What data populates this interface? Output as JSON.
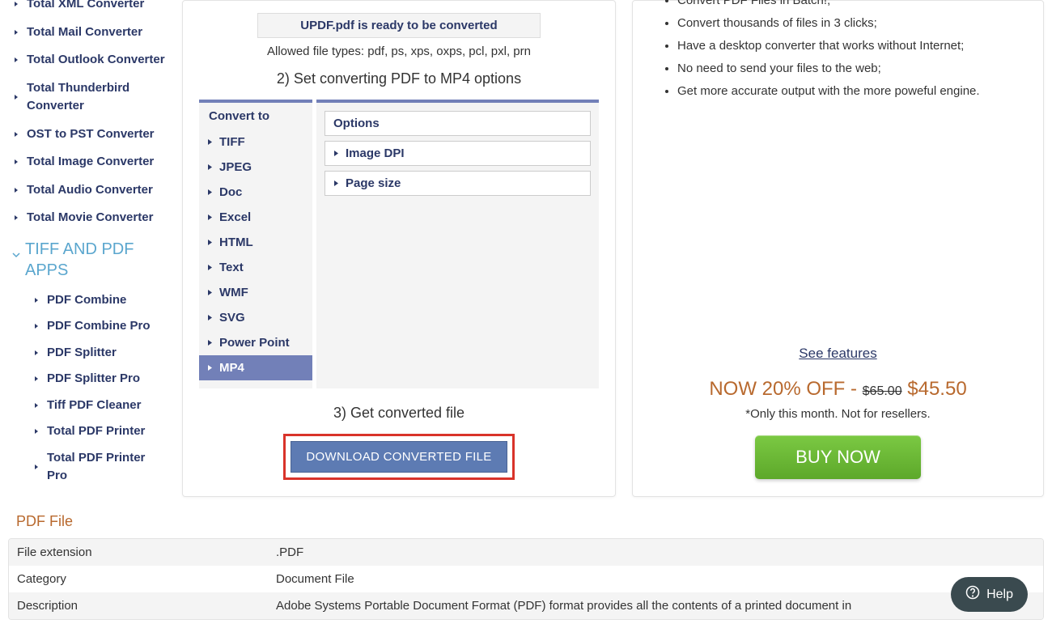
{
  "sidebar": {
    "group1_items": [
      "Total XML Converter",
      "Total Mail Converter",
      "Total Outlook Converter",
      "Total Thunderbird Converter",
      "OST to PST Converter",
      "Total Image Converter",
      "Total Audio Converter",
      "Total Movie Converter"
    ],
    "category_header": "TIFF AND PDF APPS",
    "group2_items": [
      "PDF Combine",
      "PDF Combine Pro",
      "PDF Splitter",
      "PDF Splitter Pro",
      "Tiff PDF Cleaner",
      "Total PDF Printer",
      "Total PDF Printer Pro"
    ]
  },
  "main": {
    "ready_text": "UPDF.pdf is ready to be converted",
    "allowed": "Allowed file types: pdf, ps, xps, oxps, pcl, pxl, prn",
    "step2": "2) Set converting PDF to MP4 options",
    "convert_header": "Convert to",
    "formats": [
      "TIFF",
      "JPEG",
      "Doc",
      "Excel",
      "HTML",
      "Text",
      "WMF",
      "SVG",
      "Power Point",
      "MP4"
    ],
    "active_format_index": 9,
    "options_header": "Options",
    "options": [
      "Image DPI",
      "Page size"
    ],
    "step3": "3) Get converted file",
    "download_label": "DOWNLOAD CONVERTED FILE"
  },
  "right": {
    "bullets": [
      "Convert PDF Files in Batch!;",
      "Convert thousands of files in 3 clicks;",
      "Have a desktop converter that works without Internet;",
      "No need to send your files to the web;",
      "Get more accurate output with the more poweful engine."
    ],
    "see_features": "See features",
    "now_off": "NOW 20% OFF -",
    "old_price": "$65.00",
    "new_price": "$45.50",
    "note": "*Only this month. Not for resellers.",
    "buy": "BUY NOW"
  },
  "pdf_section": {
    "title": "PDF File",
    "rows": [
      {
        "k": "File extension",
        "v": ".PDF"
      },
      {
        "k": "Category",
        "v": "Document File"
      },
      {
        "k": "Description",
        "v": "Adobe Systems Portable Document Format (PDF) format provides all the contents of a printed document in"
      }
    ]
  },
  "help": "Help"
}
